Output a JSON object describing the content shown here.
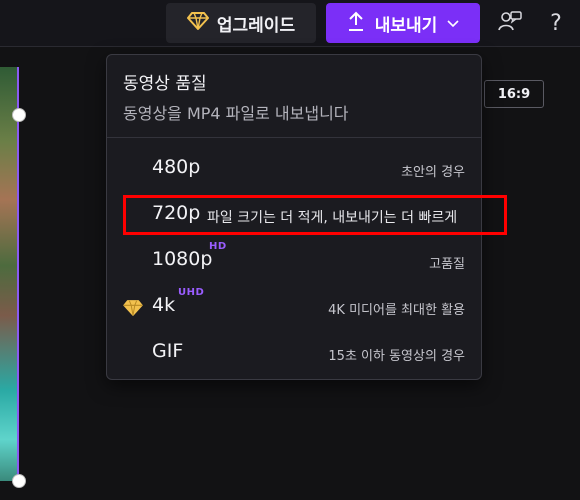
{
  "topbar": {
    "upgrade_label": "업그레이드",
    "export_label": "내보내기"
  },
  "canvas": {
    "aspect_ratio": "16:9"
  },
  "export_menu": {
    "title": "동영상 품질",
    "subtitle": "동영상을 MP4 파일로 내보냅니다",
    "options": [
      {
        "label": "480p",
        "badge": "",
        "description": "초안의 경우",
        "premium": false,
        "highlighted": false
      },
      {
        "label": "720p",
        "badge": "",
        "description": "파일 크기는 더 적게, 내보내기는 더 빠르게",
        "premium": false,
        "highlighted": true
      },
      {
        "label": "1080p",
        "badge": "HD",
        "description": "고품질",
        "premium": false,
        "highlighted": false
      },
      {
        "label": "4k",
        "badge": "UHD",
        "description": "4K 미디어를 최대한 활용",
        "premium": true,
        "highlighted": false
      },
      {
        "label": "GIF",
        "badge": "",
        "description": "15초 이하 동영상의 경우",
        "premium": false,
        "highlighted": false
      }
    ]
  },
  "colors": {
    "accent": "#7b2ff7",
    "badge": "#9a5dff",
    "highlight": "#ff0000",
    "gem": "#f2c14e"
  },
  "icons": {
    "upgrade": "diamond-icon",
    "export": "upload-arrow-icon",
    "dropdown": "chevron-down-icon",
    "feedback": "feedback-icon",
    "help": "help-icon"
  }
}
